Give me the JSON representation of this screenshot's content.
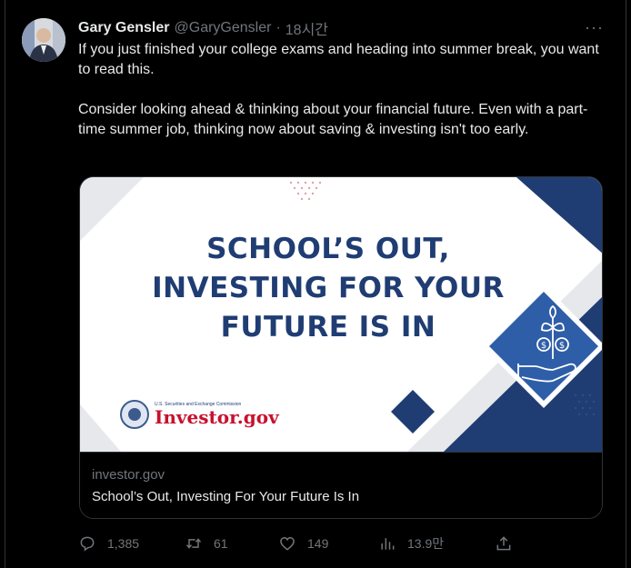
{
  "tweet": {
    "author_name": "Gary Gensler",
    "handle": "@GaryGensler",
    "separator": "·",
    "time": "18시간",
    "more_label": "···",
    "paragraphs": [
      "If you just finished your college exams and heading into summer break, you want to read this.",
      "Consider looking ahead & thinking about your financial future. Even with a part-time summer job, thinking now about saving & investing isn't too early."
    ]
  },
  "card": {
    "headline_lines": [
      "SCHOOL’S OUT,",
      "INVESTING FOR YOUR",
      "FUTURE IS IN"
    ],
    "brand_small": "U.S. Securities and Exchange Commission",
    "brand_name": "Investor.gov",
    "domain": "investor.gov",
    "title": "School’s Out, Investing For Your Future Is In"
  },
  "actions": {
    "replies": "1,385",
    "retweets": "61",
    "likes": "149",
    "views": "13.9만"
  },
  "colors": {
    "background": "#000000",
    "text": "#e7e9ea",
    "muted": "#71767b",
    "border": "#2f3336",
    "navy": "#1f3d73",
    "blue": "#2f5ea8",
    "brand_red": "#c8102e"
  },
  "icons": [
    "more-icon",
    "reply-icon",
    "retweet-icon",
    "like-icon",
    "views-icon",
    "share-icon",
    "plant-money-icon",
    "sec-seal-icon"
  ]
}
